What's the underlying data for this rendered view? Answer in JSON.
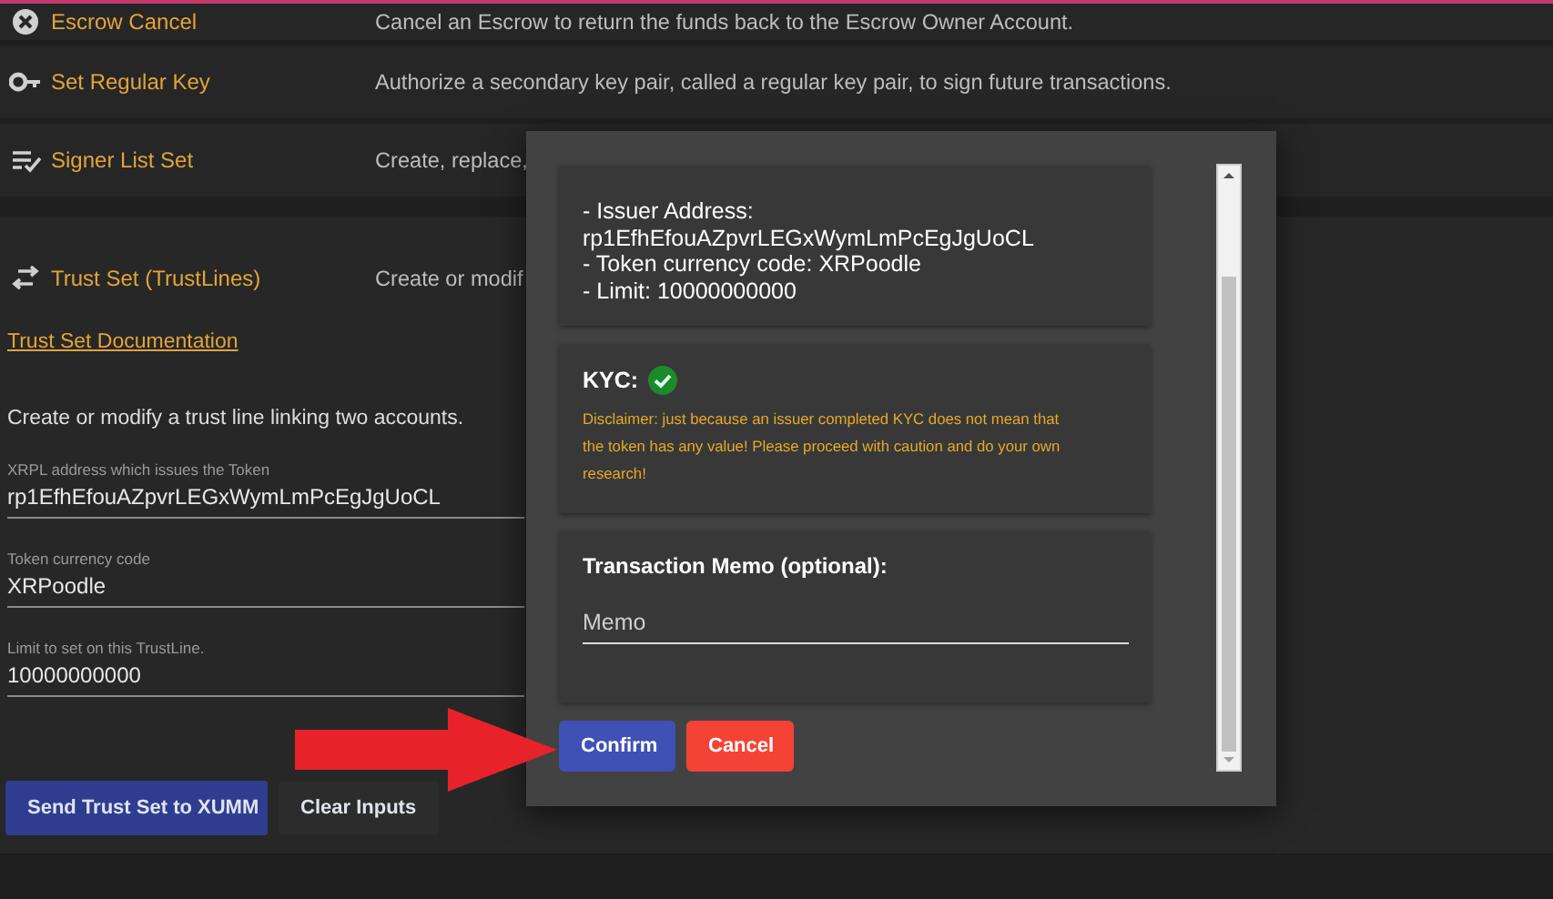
{
  "actions": [
    {
      "title": "Escrow Cancel",
      "description": "Cancel an Escrow to return the funds back to the Escrow Owner Account.",
      "expanded": false
    },
    {
      "title": "Set Regular Key",
      "description": "Authorize a secondary key pair, called a regular key pair, to sign future transactions.",
      "expanded": false
    },
    {
      "title": "Signer List Set",
      "description": "Create, replace,",
      "expanded": false
    },
    {
      "title": "Trust Set (TrustLines)",
      "description": "Create or modif",
      "expanded": true
    }
  ],
  "trust_set": {
    "doc_link": "Trust Set Documentation",
    "intro": "Create or modify a trust line linking two accounts.",
    "fields": [
      {
        "label": "XRPL address which issues the Token",
        "value": "rp1EfhEfouAZpvrLEGxWymLmPcEgJgUoCL"
      },
      {
        "label": "Token currency code",
        "value": "XRPoodle"
      },
      {
        "label": "Limit to set on this TrustLine.",
        "value": "10000000000"
      }
    ],
    "buttons": [
      {
        "label": "Send Trust Set to XUMM",
        "kind": "primary"
      },
      {
        "label": "Clear Inputs",
        "kind": "plain"
      }
    ]
  },
  "dialog": {
    "summary_lines": [
      "- Issuer Address:",
      "rp1EfhEfouAZpvrLEGxWymLmPcEgJgUoCL",
      "- Token currency code: XRPoodle",
      "- Limit: 10000000000"
    ],
    "kyc": {
      "label": "KYC:",
      "verified": true,
      "disclaimer": "Disclaimer: just because an issuer completed KYC does not mean that the token has any value! Please proceed with caution and do your own research!"
    },
    "memo": {
      "title": "Transaction Memo (optional):",
      "placeholder": "Memo"
    },
    "buttons": [
      {
        "label": "Confirm",
        "kind": "confirm"
      },
      {
        "label": "Cancel",
        "kind": "cancel"
      }
    ]
  }
}
